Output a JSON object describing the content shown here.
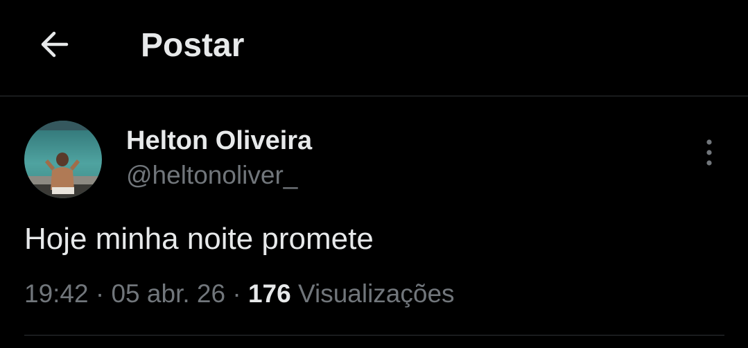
{
  "header": {
    "back_icon": "arrow-left-icon",
    "title": "Postar"
  },
  "post": {
    "author": {
      "name": "Helton Oliveira",
      "handle": "@heltonoliver_",
      "avatar_icon": "profile-photo-avatar"
    },
    "more_icon": "more-vertical-icon",
    "text": "Hoje minha noite promete",
    "time": "19:42",
    "separator": "·",
    "date": "05 abr. 26",
    "views_count": "176",
    "views_label": "Visualizações"
  },
  "colors": {
    "background": "#000000",
    "primary_text": "#e7e9ea",
    "secondary_text": "#71767b",
    "divider": "#2f3336"
  }
}
